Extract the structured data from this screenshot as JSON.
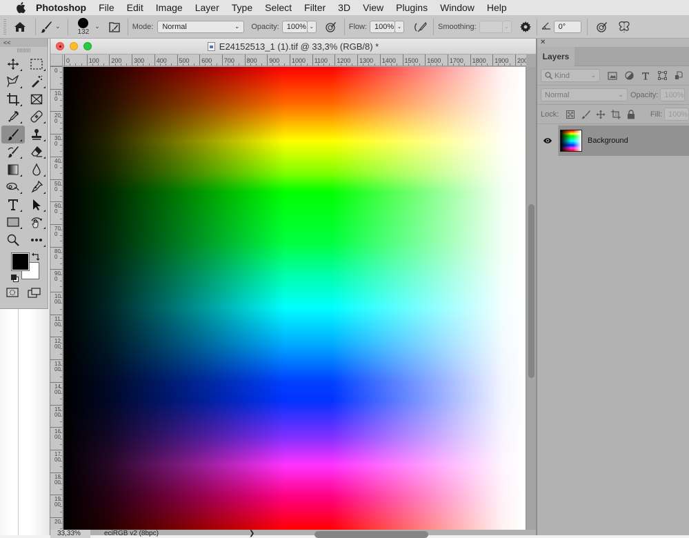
{
  "menubar": {
    "app_name": "Photoshop",
    "items": [
      "File",
      "Edit",
      "Image",
      "Layer",
      "Type",
      "Select",
      "Filter",
      "3D",
      "View",
      "Plugins",
      "Window",
      "Help"
    ]
  },
  "options": {
    "brush_size": "132",
    "mode_label": "Mode:",
    "mode_value": "Normal",
    "opacity_label": "Opacity:",
    "opacity_value": "100%",
    "flow_label": "Flow:",
    "flow_value": "100%",
    "smoothing_label": "Smoothing:",
    "smoothing_value": "",
    "angle_value": "0°"
  },
  "toolbar": {
    "collapse_label": "<<",
    "tools": [
      {
        "name": "move-tool",
        "icon": "move-icon"
      },
      {
        "name": "marquee-tool",
        "icon": "rect-marquee-icon"
      },
      {
        "name": "lasso-tool",
        "icon": "polygon-lasso-icon"
      },
      {
        "name": "magic-wand-tool",
        "icon": "magic-wand-icon"
      },
      {
        "name": "crop-tool",
        "icon": "crop-icon"
      },
      {
        "name": "frame-tool",
        "icon": "frame-icon"
      },
      {
        "name": "eyedropper-tool",
        "icon": "eyedropper-icon"
      },
      {
        "name": "healing-tool",
        "icon": "bandage-icon"
      },
      {
        "name": "brush-tool",
        "icon": "brush-icon",
        "active": true
      },
      {
        "name": "stamp-tool",
        "icon": "stamp-icon"
      },
      {
        "name": "history-brush-tool",
        "icon": "history-brush-icon"
      },
      {
        "name": "eraser-tool",
        "icon": "eraser-icon"
      },
      {
        "name": "gradient-tool",
        "icon": "gradient-icon"
      },
      {
        "name": "blur-tool",
        "icon": "drop-icon"
      },
      {
        "name": "dodge-tool",
        "icon": "lasso-select-icon"
      },
      {
        "name": "pen-tool",
        "icon": "pen-icon"
      },
      {
        "name": "type-tool",
        "icon": "type-icon"
      },
      {
        "name": "path-select-tool",
        "icon": "arrow-icon"
      },
      {
        "name": "shape-tool",
        "icon": "rectangle-icon"
      },
      {
        "name": "hand-tool",
        "icon": "hand-rotate-icon"
      },
      {
        "name": "zoom-tool",
        "icon": "zoom-icon"
      },
      {
        "name": "more-tools",
        "icon": "ellipsis-icon"
      }
    ],
    "foreground_color": "#000000",
    "background_color": "#ffffff"
  },
  "document": {
    "title": "E24152513_1 (1).tif @ 33,3% (RGB/8) *",
    "h_ruler": [
      "0",
      "100",
      "200",
      "300",
      "400",
      "500",
      "600",
      "700",
      "800",
      "900",
      "1000",
      "1100",
      "1200",
      "1300",
      "1400",
      "1500",
      "1600",
      "1700",
      "1800",
      "1900",
      "200"
    ],
    "v_ruler": [
      "0",
      "100",
      "200",
      "300",
      "400",
      "500",
      "600",
      "700",
      "800",
      "900",
      "1000",
      "1100",
      "1200",
      "1300",
      "1400",
      "1500",
      "1600",
      "1700",
      "1800",
      "1900",
      "20"
    ],
    "zoom_level": "33,33%",
    "color_profile": "eciRGB v2 (8bpc)",
    "status_arrow": "❯"
  },
  "layers_panel": {
    "tab_label": "Layers",
    "filter_kind": "Kind",
    "blend_mode": "Normal",
    "opacity_label": "Opacity:",
    "opacity_value": "100%",
    "lock_label": "Lock:",
    "fill_label": "Fill:",
    "fill_value": "100%",
    "layers": [
      {
        "name": "Background",
        "visible": true
      }
    ]
  }
}
